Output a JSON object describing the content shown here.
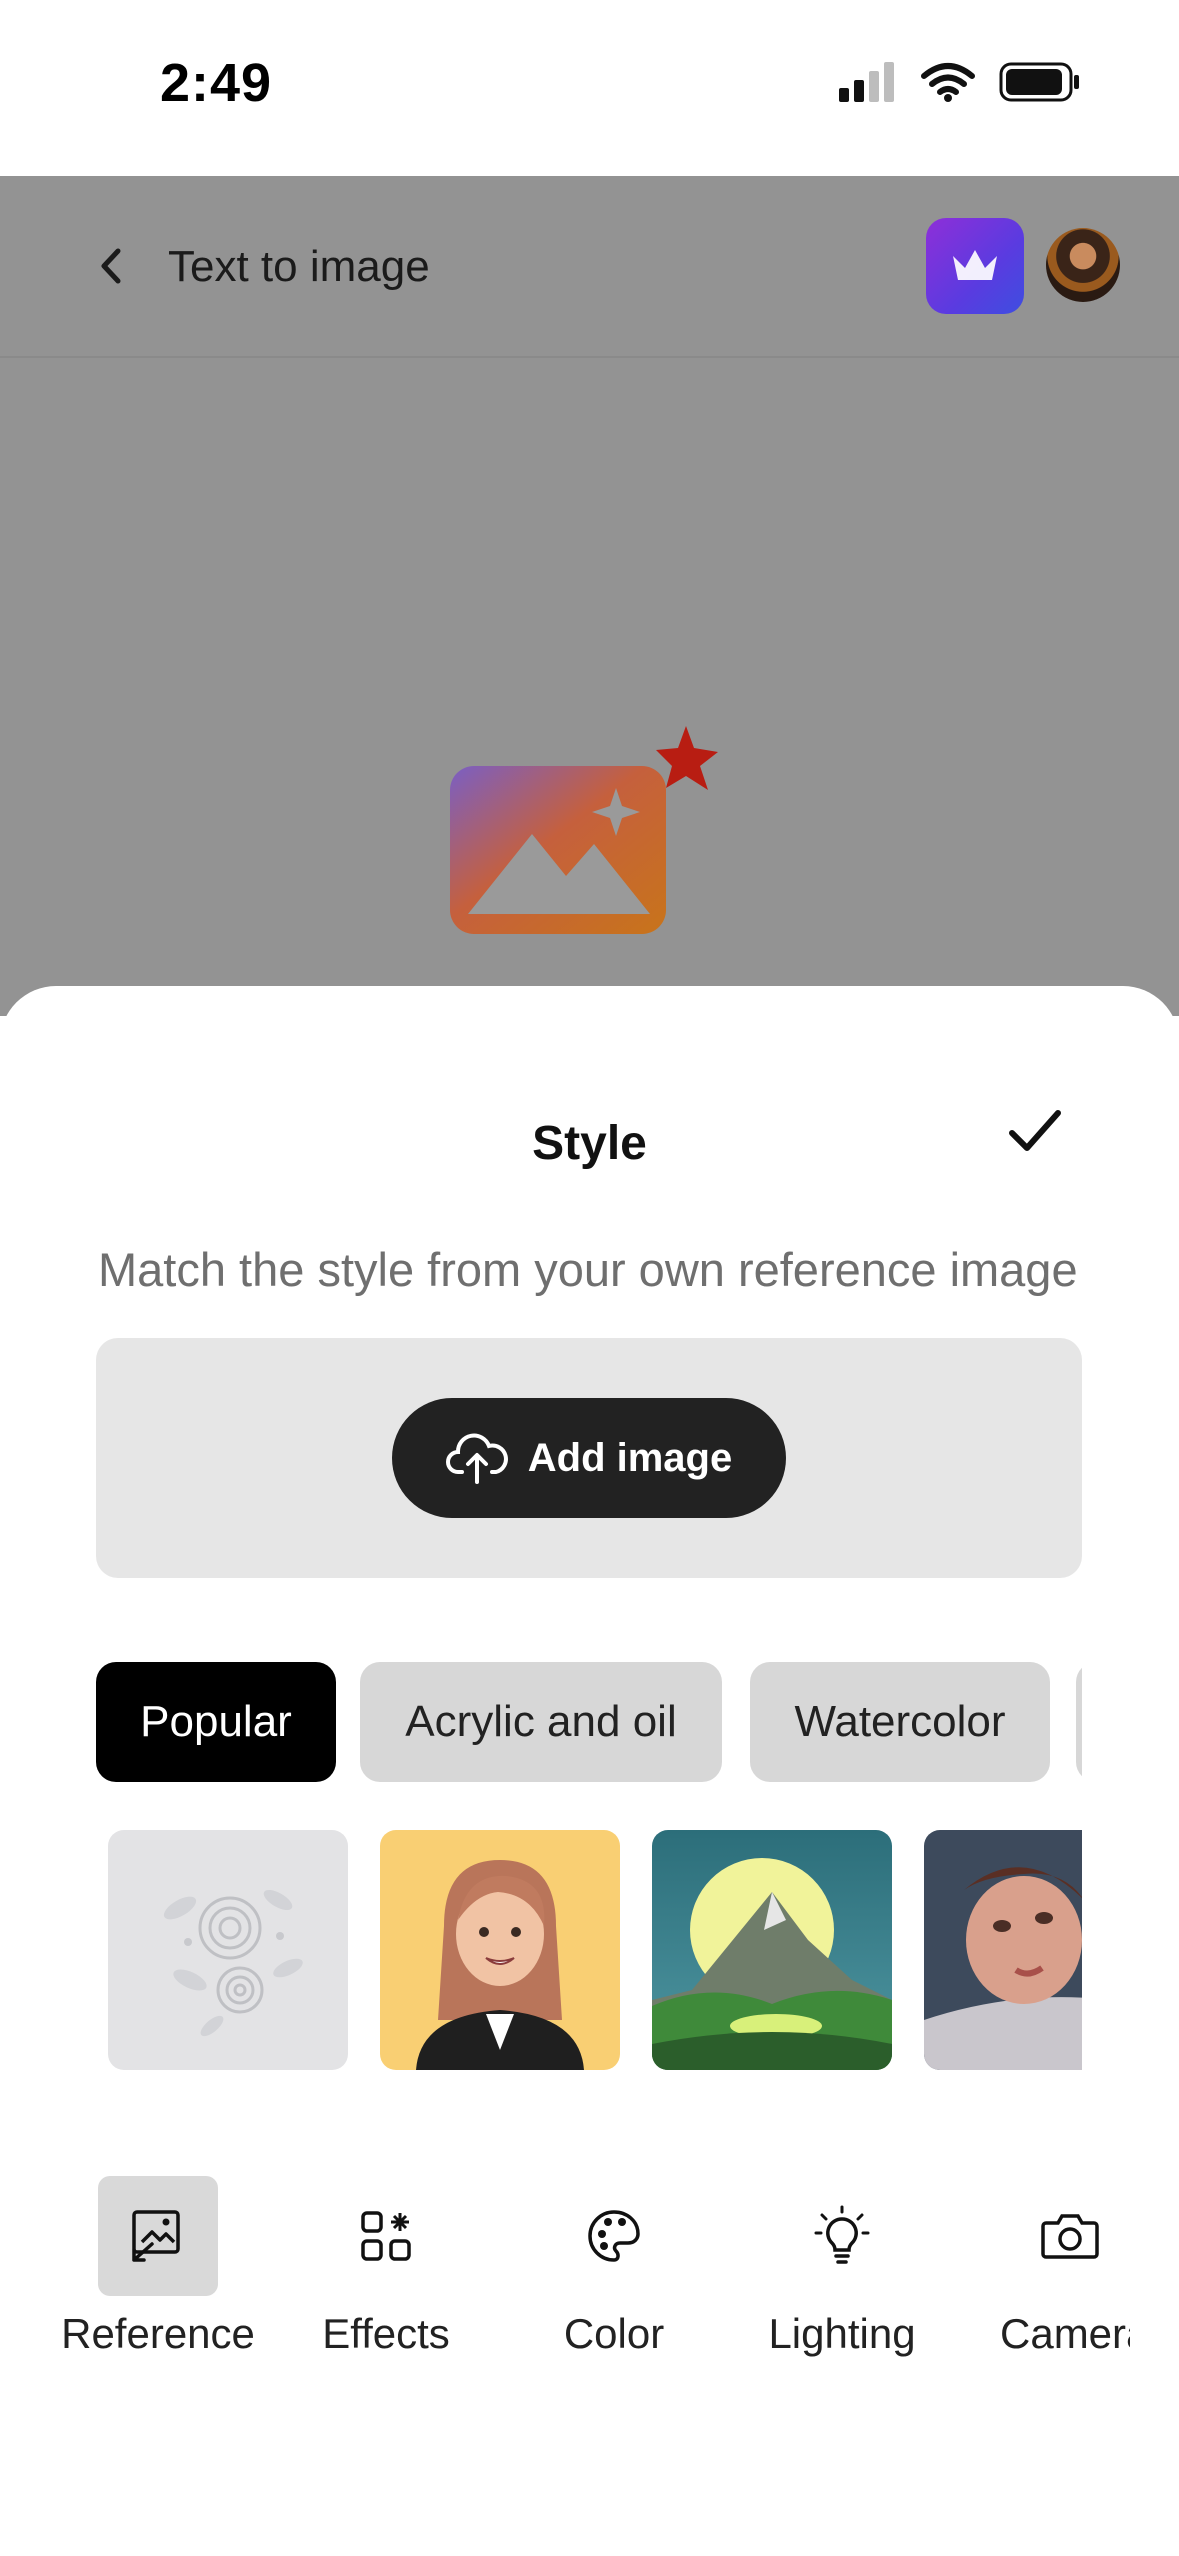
{
  "status_bar": {
    "time": "2:49"
  },
  "header": {
    "title": "Text to image"
  },
  "sheet": {
    "title": "Style",
    "subtitle": "Match the style from your own reference image",
    "add_image_label": "Add image"
  },
  "style_categories": [
    {
      "label": "Popular",
      "selected": true
    },
    {
      "label": "Acrylic and oil",
      "selected": false
    },
    {
      "label": "Watercolor",
      "selected": false
    }
  ],
  "toolbar": [
    {
      "label": "Reference",
      "icon": "reference-image-icon",
      "selected": true
    },
    {
      "label": "Effects",
      "icon": "effects-grid-icon",
      "selected": false
    },
    {
      "label": "Color",
      "icon": "palette-icon",
      "selected": false
    },
    {
      "label": "Lighting",
      "icon": "lightbulb-icon",
      "selected": false
    },
    {
      "label": "Camera",
      "icon": "camera-icon",
      "selected": false
    }
  ],
  "colors": {
    "accent_dark": "#222222",
    "chip_selected": "#000000",
    "chip_default": "#d7d7d7",
    "premium_gradient_start": "#8e2fd8",
    "premium_gradient_end": "#3e4ee0"
  }
}
